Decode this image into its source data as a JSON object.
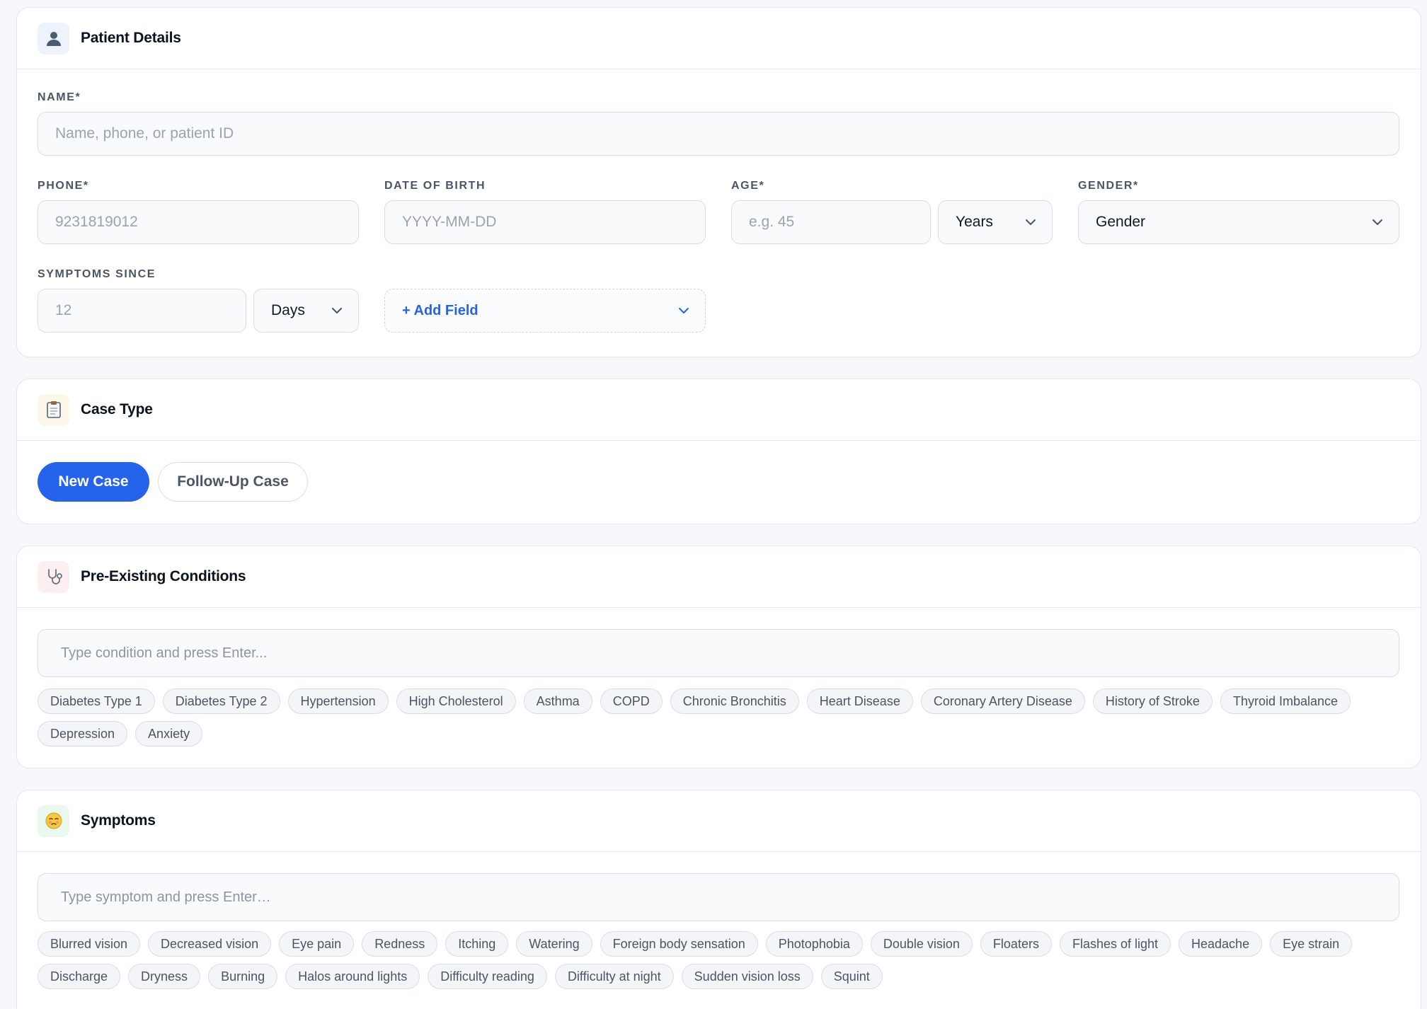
{
  "colors": {
    "accent": "#2563eb",
    "border": "#d8dee7",
    "field_bg": "#f8fafc",
    "muted_text": "#4b5563"
  },
  "patient": {
    "title": "Patient Details",
    "icon": "user-icon",
    "name_label": "NAME*",
    "name_placeholder": "Name, phone, or patient ID",
    "phone_label": "PHONE*",
    "phone_placeholder": "9231819012",
    "dob_label": "DATE OF BIRTH",
    "dob_placeholder": "YYYY-MM-DD",
    "age_label": "AGE*",
    "age_placeholder": "e.g. 45",
    "age_unit": "Years",
    "gender_label": "GENDER*",
    "gender_value": "Gender",
    "since_label": "SYMPTOMS SINCE",
    "since_placeholder": "12",
    "since_unit": "Days",
    "add_field": "+ Add Field"
  },
  "case_type": {
    "title": "Case Type",
    "icon": "clipboard-icon",
    "new_case": "New Case",
    "follow_up": "Follow-Up Case"
  },
  "conditions": {
    "title": "Pre-Existing Conditions",
    "icon": "stethoscope-icon",
    "placeholder": "Type condition and press Enter...",
    "chips": [
      "Diabetes Type 1",
      "Diabetes Type 2",
      "Hypertension",
      "High Cholesterol",
      "Asthma",
      "COPD",
      "Chronic Bronchitis",
      "Heart Disease",
      "Coronary Artery Disease",
      "History of Stroke",
      "Thyroid Imbalance",
      "Depression",
      "Anxiety"
    ]
  },
  "symptoms": {
    "title": "Symptoms",
    "icon": "sick-face-icon",
    "placeholder": "Type symptom and press Enter…",
    "chips": [
      "Blurred vision",
      "Decreased vision",
      "Eye pain",
      "Redness",
      "Itching",
      "Watering",
      "Foreign body sensation",
      "Photophobia",
      "Double vision",
      "Floaters",
      "Flashes of light",
      "Headache",
      "Eye strain",
      "Discharge",
      "Dryness",
      "Burning",
      "Halos around lights",
      "Difficulty reading",
      "Difficulty at night",
      "Sudden vision loss",
      "Squint"
    ]
  }
}
